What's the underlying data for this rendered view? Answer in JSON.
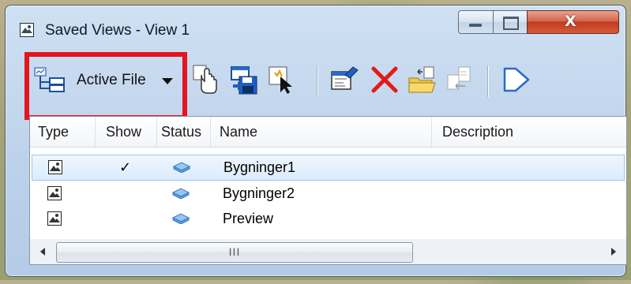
{
  "window": {
    "title": "Saved Views - View 1"
  },
  "toolbar": {
    "active_file_label": "Active File",
    "tools": [
      "apply-view-icon",
      "save-view-icon",
      "select-view-icon",
      "properties-icon",
      "delete-icon",
      "import-icon",
      "export-icon",
      "flag-icon"
    ]
  },
  "list": {
    "columns": [
      "Type",
      "Show",
      "Status",
      "Name",
      "Description"
    ],
    "rows": [
      {
        "show": "✓",
        "name": "Bygninger1",
        "description": ""
      },
      {
        "show": "",
        "name": "Bygninger2",
        "description": ""
      },
      {
        "show": "",
        "name": "Preview",
        "description": ""
      }
    ]
  },
  "scrollbar": {
    "grip": "III"
  },
  "colors": {
    "highlight": "#e5141e",
    "delete": "#e11b1b",
    "selection": "#dcecfc"
  }
}
